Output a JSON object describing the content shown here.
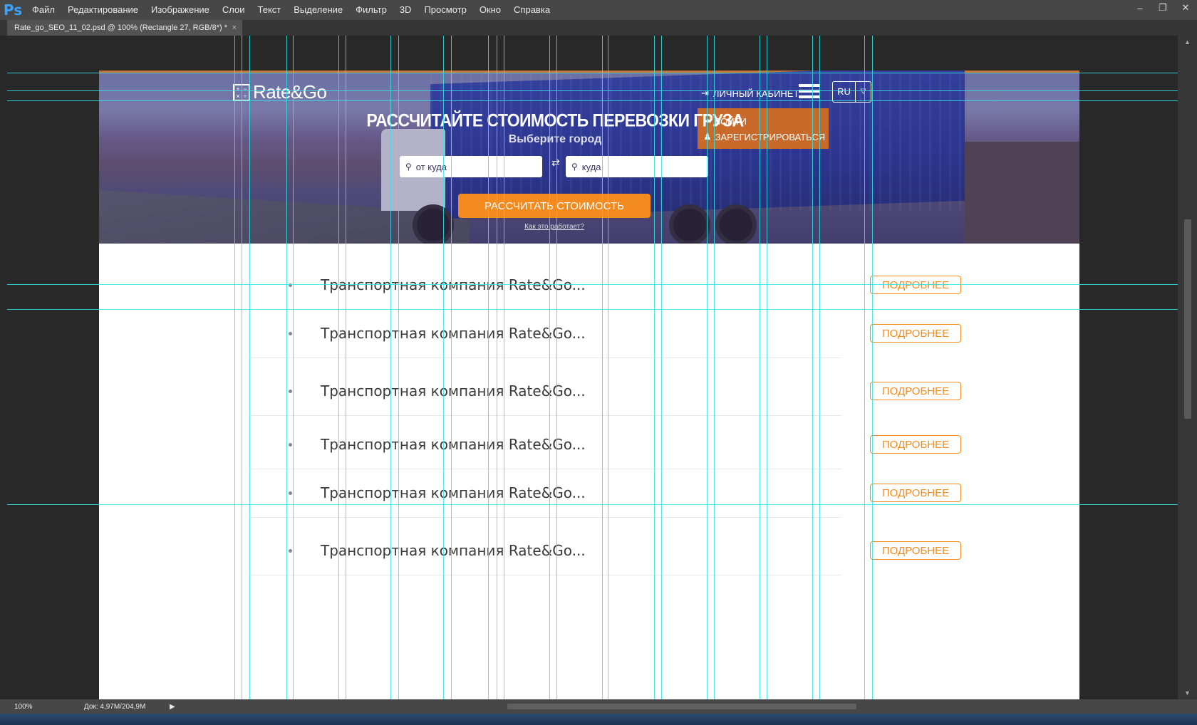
{
  "app": {
    "logo": "Ps",
    "menu": [
      "Файл",
      "Редактирование",
      "Изображение",
      "Слои",
      "Текст",
      "Выделение",
      "Фильтр",
      "3D",
      "Просмотр",
      "Окно",
      "Справка"
    ],
    "window_controls": [
      "–",
      "❐",
      "✕"
    ]
  },
  "document_tab": {
    "title": "Rate_go_SEO_11_02.psd @ 100% (Rectangle 27, RGB/8*) *",
    "close": "×"
  },
  "status": {
    "zoom": "100%",
    "doc": "Док: 4,97M/204,9M",
    "arrow": "▶"
  },
  "site": {
    "logo_text": "Rate&Go",
    "cabinet": "ЛИЧНЫЙ КАБИНЕТ",
    "language": "RU",
    "auth": {
      "login": "ВОЙТИ",
      "register": "ЗАРЕГИСТРИРОВАТЬСЯ"
    },
    "hero": {
      "title": "РАССЧИТАЙТЕ СТОИМОСТЬ ПЕРЕВОЗКИ ГРУЗА",
      "subtitle": "Выберите город",
      "from_placeholder": "от куда",
      "to_placeholder": "куда",
      "calc_button": "РАССЧИТАТЬ СТОИМОСТЬ",
      "how_link": "Как это работает?"
    },
    "list": [
      {
        "text": "Транспортная компания Rate&Go...",
        "button": "ПОДРОБНЕЕ"
      },
      {
        "text": "Транспортная компания Rate&Go...",
        "button": "ПОДРОБНЕЕ"
      },
      {
        "text": "Транспортная компания Rate&Go...",
        "button": "ПОДРОБНЕЕ"
      },
      {
        "text": "Транспортная компания Rate&Go...",
        "button": "ПОДРОБНЕЕ"
      },
      {
        "text": "Транспортная компания Rate&Go...",
        "button": "ПОДРОБНЕЕ"
      },
      {
        "text": "Транспортная компания Rate&Go...",
        "button": "ПОДРОБНЕЕ"
      }
    ]
  },
  "colors": {
    "accent": "#f28a1d",
    "guide": "#35e3e9",
    "ps_dark": "#282828",
    "auth_dropdown": "#c96a2a"
  }
}
